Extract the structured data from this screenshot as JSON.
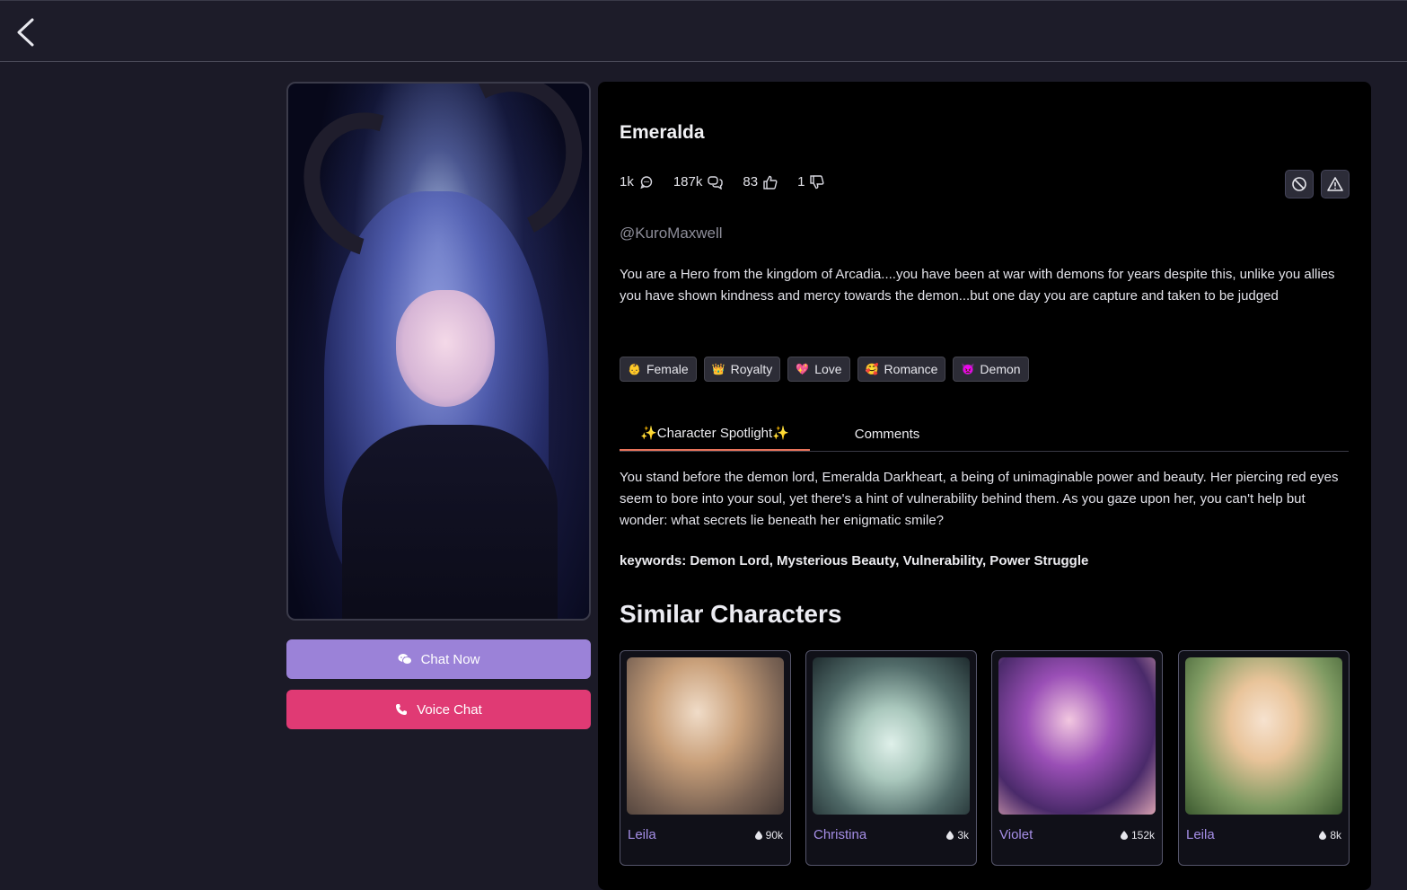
{
  "header": {
    "back_icon": "chevron-left-icon"
  },
  "character": {
    "name": "Emeralda",
    "stats": [
      {
        "value": "1k",
        "icon": "chat-bubble-icon"
      },
      {
        "value": "187k",
        "icon": "chat-bubbles-icon"
      },
      {
        "value": "83",
        "icon": "thumbs-up-icon"
      },
      {
        "value": "1",
        "icon": "thumbs-down-icon"
      }
    ],
    "creator": "@KuroMaxwell",
    "description": "You are a Hero from the kingdom of Arcadia....you have been at war with demons for years despite this, unlike you allies you have shown kindness and mercy towards the demon...but one day you are capture and taken to be judged",
    "tags": [
      {
        "emoji": "👶",
        "label": "Female"
      },
      {
        "emoji": "👑",
        "label": "Royalty"
      },
      {
        "emoji": "💖",
        "label": "Love"
      },
      {
        "emoji": "🥰",
        "label": "Romance"
      },
      {
        "emoji": "👿",
        "label": "Demon"
      }
    ]
  },
  "actions": {
    "chat_now": "Chat Now",
    "voice_chat": "Voice Chat"
  },
  "tabs": {
    "spotlight": "✨Character Spotlight✨",
    "comments": "Comments"
  },
  "spotlight": {
    "text": "You stand before the demon lord, Emeralda Darkheart, a being of unimaginable power and beauty. Her piercing red eyes seem to bore into your soul, yet there's a hint of vulnerability behind them. As you gaze upon her, you can't help but wonder: what secrets lie beneath her enigmatic smile?",
    "keywords": "keywords: Demon Lord, Mysterious Beauty, Vulnerability, Power Struggle"
  },
  "similar": {
    "title": "Similar Characters",
    "cards": [
      {
        "name": "Leila",
        "count": "90k"
      },
      {
        "name": "Christina",
        "count": "3k"
      },
      {
        "name": "Violet",
        "count": "152k"
      },
      {
        "name": "Leila",
        "count": "8k"
      }
    ]
  },
  "colors": {
    "chat_button": "#9b82d8",
    "voice_button": "#e03a74",
    "tab_underline": "#e8735a",
    "card_name": "#a58ee6"
  }
}
